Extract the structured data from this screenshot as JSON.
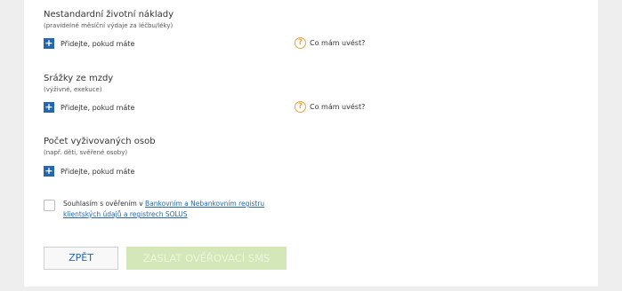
{
  "sections": [
    {
      "title": "Nestandardní životní náklady",
      "subtitle": "(pravidelné měsíční výdaje za léčbu/léky)",
      "add_label": "Přidejte, pokud máte",
      "help_label": "Co mám uvést?"
    },
    {
      "title": "Srážky ze mzdy",
      "subtitle": "(výživné, exekuce)",
      "add_label": "Přidejte, pokud máte",
      "help_label": "Co mám uvést?"
    },
    {
      "title": "Počet vyživovaných osob",
      "subtitle": "(např. děti, svěřené osoby)",
      "add_label": "Přidejte, pokud máte"
    }
  ],
  "icons": {
    "plus": "+",
    "help": "?"
  },
  "consent": {
    "text": "Souhlasím s ověřením v ",
    "link": "Bankovním a Nebankovním registru klientských údajů a registrech SOLUS",
    "checked": false
  },
  "buttons": {
    "back": "ZPĚT",
    "send_sms": "ZASLAT OVĚŘOVACÍ SMS"
  },
  "colors": {
    "accent": "#2467b1",
    "help": "#e8a53c",
    "sms_disabled": "#d3e7b8"
  }
}
